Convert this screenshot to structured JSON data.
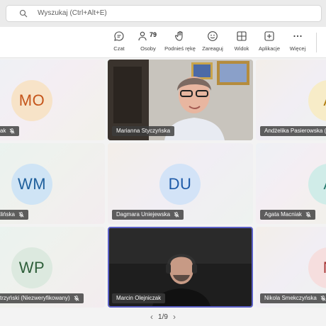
{
  "search": {
    "placeholder": "Wyszukaj (Ctrl+Alt+E)"
  },
  "toolbar": {
    "chat": {
      "label": "Czat",
      "icon": "chat-icon"
    },
    "people": {
      "label": "Osoby",
      "count": "79",
      "icon": "people-icon"
    },
    "raise_hand": {
      "label": "Podnieś rękę",
      "icon": "hand-icon"
    },
    "react": {
      "label": "Zareaguj",
      "icon": "smiley-icon"
    },
    "view": {
      "label": "Widok",
      "icon": "grid-icon"
    },
    "apps": {
      "label": "Aplikacje",
      "icon": "add-app-icon"
    },
    "more": {
      "label": "Więcej",
      "icon": "more-icon"
    }
  },
  "tiles": [
    {
      "name": "zak",
      "initials": "MO",
      "avatar_color": "#f7e3c8",
      "initials_color": "#c5551a",
      "muted": true
    },
    {
      "name": "Marianna Styczyńska",
      "video": true,
      "muted": false
    },
    {
      "name": "Andżelika Pasierowska (",
      "initials": "A",
      "avatar_color": "#f7ecc8",
      "initials_color": "#b07d10",
      "muted": false
    },
    {
      "name": "alińska",
      "initials": "WM",
      "avatar_color": "#cfe4f5",
      "initials_color": "#1f5f9c",
      "muted": true
    },
    {
      "name": "Dagmara Uniejewska",
      "initials": "DU",
      "avatar_color": "#d3e3f7",
      "initials_color": "#1d5aa8",
      "muted": true
    },
    {
      "name": "Agata Macniak",
      "initials": "A",
      "avatar_color": "#d0ece8",
      "initials_color": "#287a6f",
      "muted": true
    },
    {
      "name": "strzyński (Niezweryfikowany)",
      "initials": "WP",
      "avatar_color": "#dce9df",
      "initials_color": "#2e5f3a",
      "muted": true
    },
    {
      "name": "Marcin Olejniczak",
      "video": true,
      "muted": false,
      "active": true
    },
    {
      "name": "Nikola Smekczyńska",
      "initials": "N",
      "avatar_color": "#f6dede",
      "initials_color": "#a73535",
      "muted": true
    }
  ],
  "pager": {
    "text": "1/9"
  },
  "colors": {
    "accent": "#5b5fc7",
    "nameplate_bg": "#3c3c3c"
  }
}
